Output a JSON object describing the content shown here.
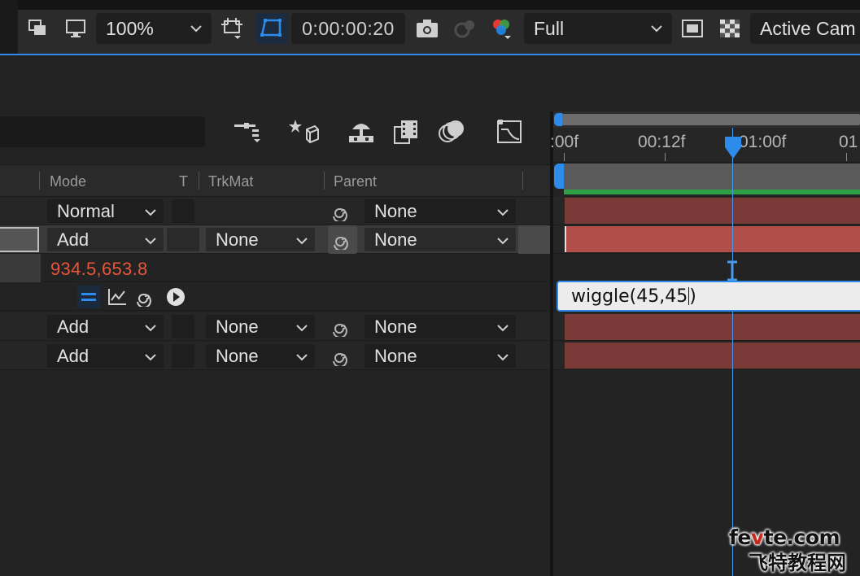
{
  "viewer_toolbar": {
    "zoom": "100%",
    "timecode": "0:00:00:20",
    "resolution": "Full",
    "view": "Active Cam"
  },
  "columns": {
    "mode": "Mode",
    "t": "T",
    "trkmat": "TrkMat",
    "parent": "Parent"
  },
  "layers": [
    {
      "mode": "Normal",
      "trkmat": "",
      "parent": "None",
      "selected": false
    },
    {
      "mode": "Add",
      "trkmat": "None",
      "parent": "None",
      "selected": true
    },
    {
      "mode": "Add",
      "trkmat": "None",
      "parent": "None",
      "selected": false
    },
    {
      "mode": "Add",
      "trkmat": "None",
      "parent": "None",
      "selected": false
    }
  ],
  "position_property": {
    "value": "934.5,653.8"
  },
  "timeline": {
    "ticks": [
      ":00f",
      "00:12f",
      "01:00f",
      "01"
    ],
    "expression": "wiggle(45,45",
    "expression_close": ")"
  },
  "watermark": {
    "domain_a": "fe",
    "domain_b": "v",
    "domain_c": "te.com",
    "chinese": "飞特教程网"
  },
  "colors": {
    "accent_blue": "#2d8ceb",
    "layer_bar": "#7a3a38",
    "layer_bar_selected": "#b24e4a",
    "value_orange": "#e8563a",
    "work_area_green": "#2ea043"
  }
}
